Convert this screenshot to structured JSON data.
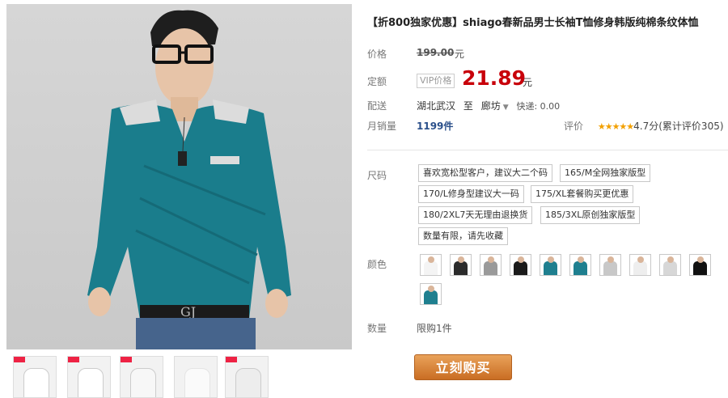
{
  "product": {
    "title": "【折800独家优惠】shiago春新品男士长袖T恤修身韩版纯棉条纹体恤"
  },
  "price": {
    "label": "价格",
    "original": "199.00",
    "original_unit": "元",
    "promo_label": "定额",
    "vip_badge": "VIP价格",
    "current": "21.89",
    "current_unit": "元"
  },
  "shipping": {
    "label": "配送",
    "from": "湖北武汉",
    "to_word": "至",
    "to": "廊坊",
    "express": "快递: 0.00"
  },
  "sales": {
    "label": "月销量",
    "count": "1199件",
    "rating_label": "评价",
    "stars": "★★★★★",
    "score": "4.7分",
    "reviews": "(累计评价305)"
  },
  "size": {
    "label": "尺码",
    "options": [
      "喜欢宽松型客户，建议大二个码",
      "165/M全网独家版型",
      "170/L修身型建议大一码",
      "175/XL套餐购买更优惠",
      "180/2XL7天无理由退换货",
      "185/3XL原创独家版型",
      "数量有限，请先收藏"
    ]
  },
  "color": {
    "label": "颜色",
    "swatches": [
      "#f4f4f4",
      "#2b2b2b",
      "#9a9a9a",
      "#1a1a1a",
      "#1f7f8f",
      "#1f7f8f",
      "#c8c8c8",
      "#eeeeee",
      "#d7d7d7",
      "#111111",
      "#1f7f8f"
    ]
  },
  "quantity": {
    "label": "数量",
    "limit": "限购1件"
  },
  "buy_button": "立刻购买",
  "colors": {
    "accent_price": "#c8000a",
    "shirt": "#1a7d8c",
    "buy_button": "#d37e30"
  }
}
